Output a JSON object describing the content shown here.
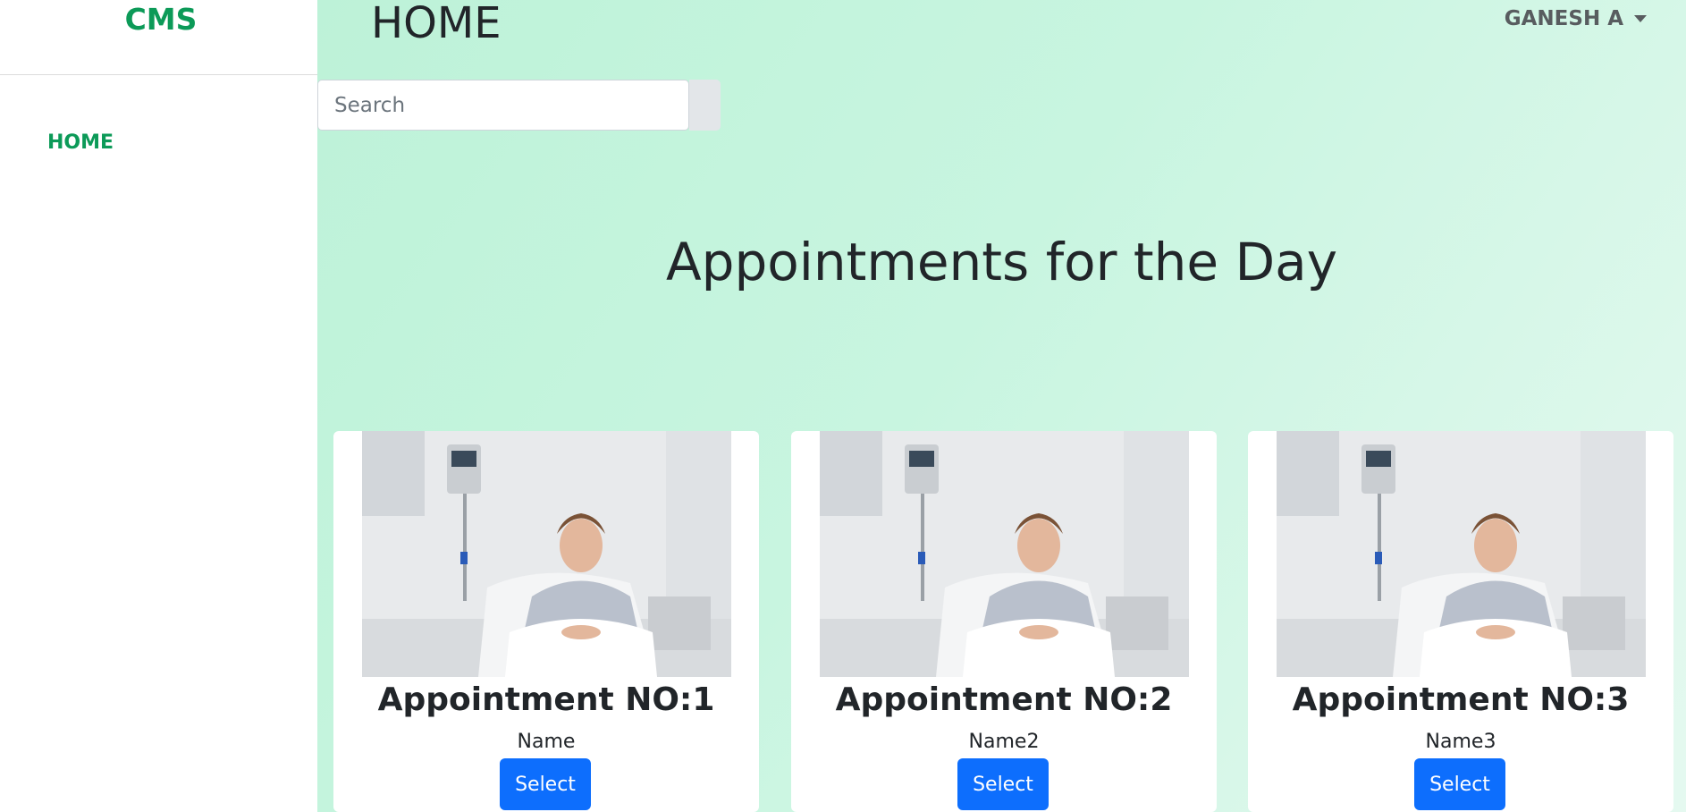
{
  "sidebar": {
    "brand": "CMS",
    "items": [
      {
        "label": "HOME"
      }
    ]
  },
  "header": {
    "title": "HOME",
    "user": "GANESH A"
  },
  "search": {
    "placeholder": "Search"
  },
  "main": {
    "heading": "Appointments for the Day",
    "cards": [
      {
        "title": "Appointment NO:1",
        "name": "Name",
        "button": "Select"
      },
      {
        "title": "Appointment NO:2",
        "name": "Name2",
        "button": "Select"
      },
      {
        "title": "Appointment NO:3",
        "name": "Name3",
        "button": "Select"
      }
    ]
  },
  "colors": {
    "accent_green": "#0c9a58",
    "button_blue": "#0d6efd",
    "background_mint": "#c3f3dc"
  }
}
